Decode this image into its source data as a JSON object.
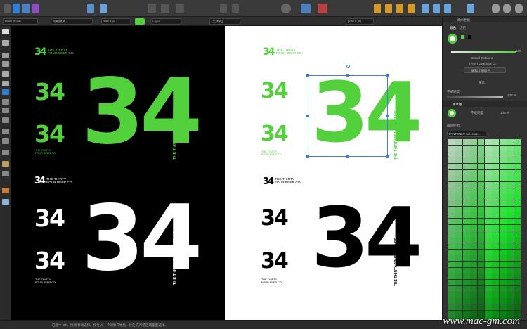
{
  "context_bar": {
    "brush": "Draft Brush",
    "mode": "常规模式",
    "width": "249.8 px",
    "layer": "Logo",
    "opacity_a": "[无样式]",
    "size_b": "[249.8 pt]"
  },
  "canvas": {
    "brand_line1": "THE THIRTY",
    "brand_line2": "FOUR BEER CO.",
    "big_number": "34",
    "small_number": "34",
    "vertical_text": "THE THIRTY FOUR BEER CO."
  },
  "panel": {
    "tab_a": "颜色",
    "tab_b": "历史",
    "tab_c": "样式/色板",
    "global_colour": "Global Colour 1",
    "pantone": "(PANTONE 802 C)",
    "edit_label": "编辑全局颜色",
    "recolor": "重选",
    "opacity_label": "不透明度",
    "opacity_value": "100 %",
    "lower_tab": "样本板",
    "lower_opacity_label": "不透明度:",
    "lower_opacity_value": "100 %",
    "palette_header": "最近使用:",
    "palette_name": "PANTONE® Sol. coat...",
    "top_value": "100"
  },
  "status": {
    "text": "已选中 '34'。拖动 移动选择。按住 从一个对象开始拖。按住 在所选区域里面选择。"
  },
  "colors": {
    "accent_green": "#52d13c",
    "bg_dark": "#2a2a2a"
  },
  "watermark": "www.mac-gm.com"
}
